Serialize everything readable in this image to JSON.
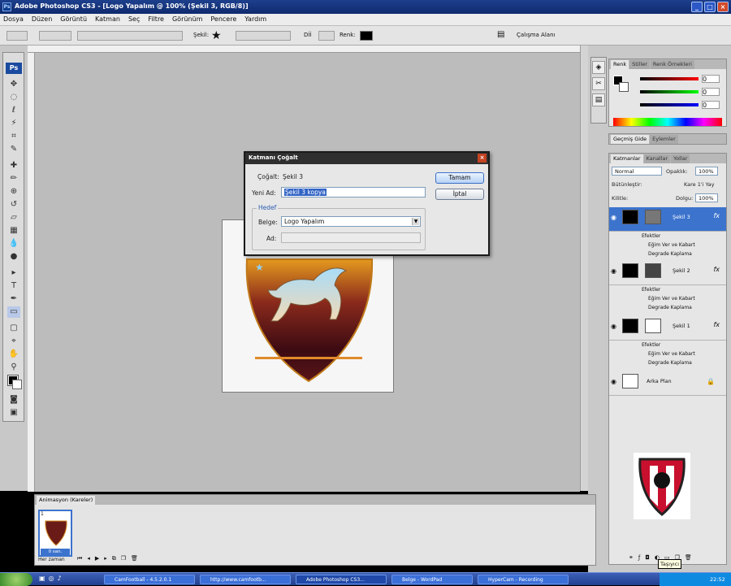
{
  "window": {
    "title": "Adobe Photoshop CS3 - [Logo Yapalım @ 100% (Şekil 3, RGB/8)]"
  },
  "menu": [
    "Dosya",
    "Düzen",
    "Görüntü",
    "Katman",
    "Seç",
    "Filtre",
    "Görünüm",
    "Pencere",
    "Yardım"
  ],
  "options": {
    "shape_label": "Şekil:",
    "color_label": "Renk:",
    "mode_label": "Dİİ",
    "workspace": "Çalışma Alanı"
  },
  "dialog": {
    "title": "Katmanı Çoğalt",
    "duplicate_label": "Çoğalt:",
    "duplicate_value": "Şekil 3",
    "as_label": "Yeni Ad:",
    "as_value": "Şekil 3 kopya",
    "dest_group": "Hedef",
    "doc_label": "Belge:",
    "doc_value": "Logo Yapalım",
    "name_label": "Ad:",
    "ok": "Tamam",
    "cancel": "İptal"
  },
  "color_panel": {
    "tabs": [
      "Renk",
      "Stiller",
      "Renk Örnekleri"
    ],
    "values": [
      "0",
      "0",
      "0"
    ]
  },
  "history_panel": {
    "tabs": [
      "Geçmiş Gide",
      "Eylemler"
    ]
  },
  "layers_panel": {
    "tabs": [
      "Katmanlar",
      "Kanallar",
      "Yollar"
    ],
    "blend": "Normal",
    "opacity_label": "Opaklık:",
    "opacity": "100%",
    "lock_label": "Bütünleştir:",
    "fill_label": "Dolgu:",
    "fill": "100%",
    "unify_label": "Kare 1'i Yay",
    "lock_row_label": "Kilitle:",
    "layers": [
      {
        "name": "Şekil 3",
        "effects": "Efektler",
        "fx1": "Eğim Ver ve Kabart",
        "fx2": "Degrade Kaplama",
        "selected": true
      },
      {
        "name": "Şekil 2",
        "effects": "Efektler",
        "fx1": "Eğim Ver ve Kabart",
        "fx2": "Degrade Kaplama"
      },
      {
        "name": "Şekil 1",
        "effects": "Efektler",
        "fx1": "Eğim Ver ve Kabart",
        "fx2": "Degrade Kaplama"
      }
    ],
    "background": "Arka Plan",
    "tooltip": "Taşıyıcı"
  },
  "animation": {
    "tab": "Animasyon (Kareler)",
    "frame_index": "1",
    "frame_time": "0 san.",
    "loop": "Her zaman"
  },
  "taskbar": {
    "tasks": [
      "CamFootball - 4.5.2.0.1",
      "http://www.camfootb...",
      "Adobe Photoshop CS3...",
      "Belge - WordPad",
      "HyperCam - Recording"
    ],
    "time": "22:52"
  }
}
